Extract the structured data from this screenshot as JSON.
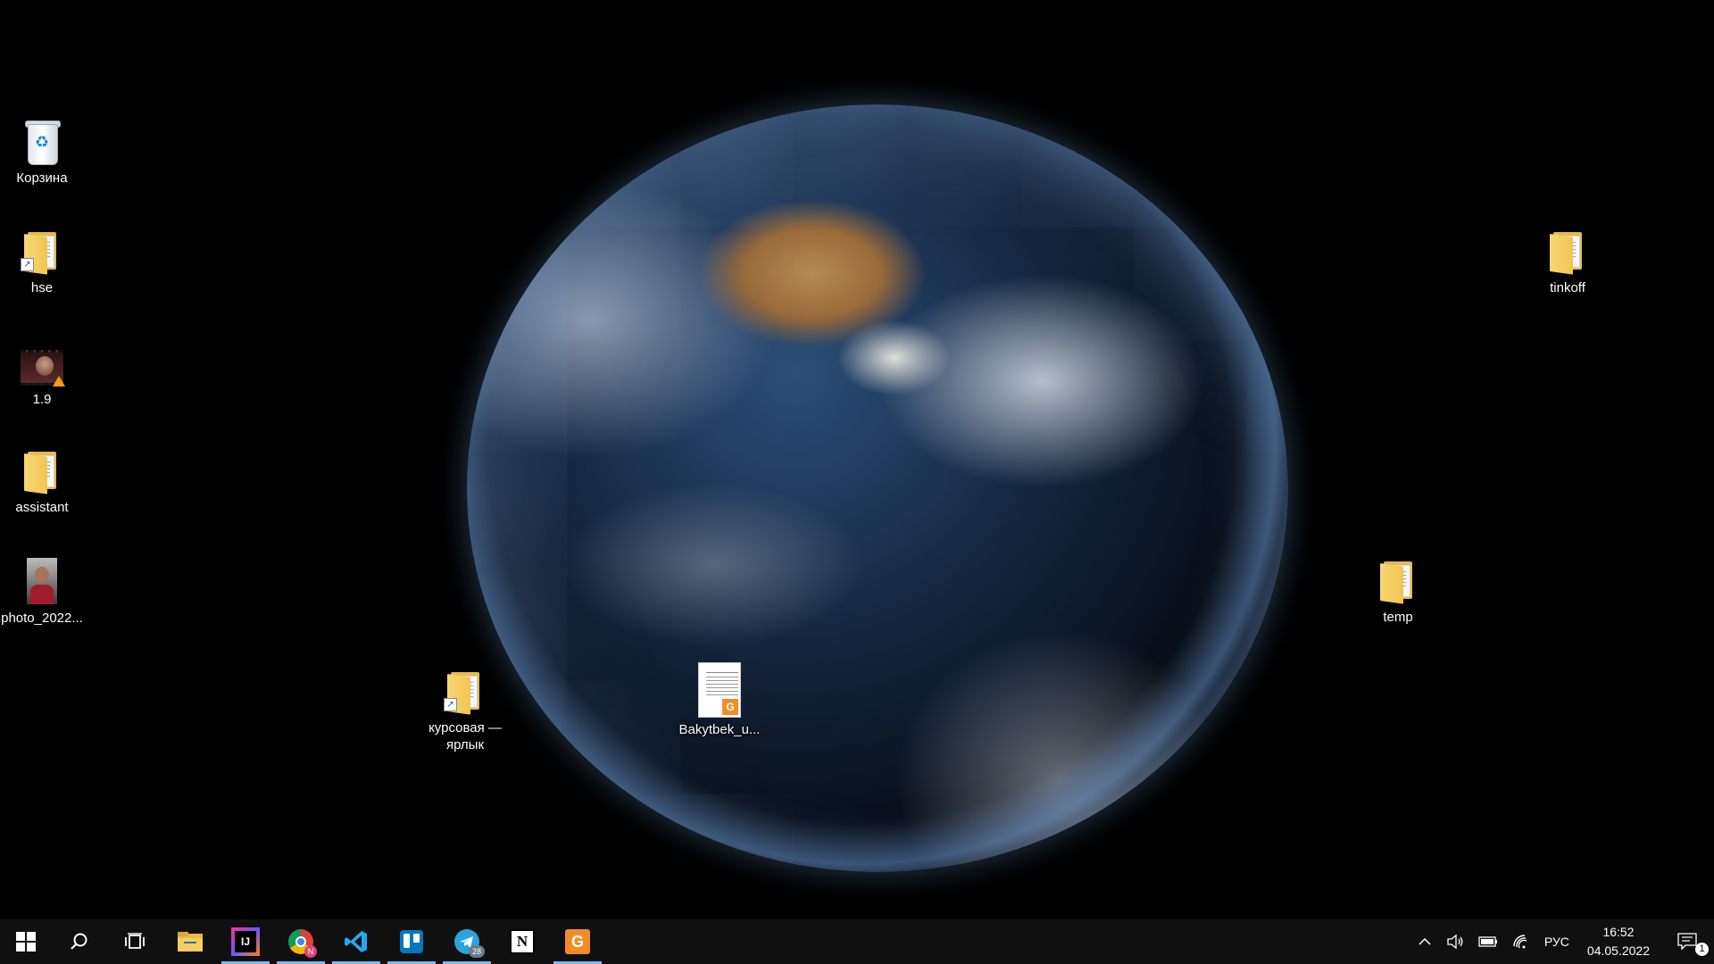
{
  "desktop": {
    "icons": [
      {
        "label": "Корзина",
        "type": "recycle-bin"
      },
      {
        "label": "hse",
        "type": "folder-shortcut"
      },
      {
        "label": "1.9",
        "type": "video"
      },
      {
        "label": "assistant",
        "type": "folder"
      },
      {
        "label": "photo_2022...",
        "type": "image"
      },
      {
        "label": "tinkoff",
        "type": "folder"
      },
      {
        "label": "temp",
        "type": "folder"
      },
      {
        "label": "курсовая — ярлык",
        "type": "folder-shortcut"
      },
      {
        "label": "Bakytbek_u...",
        "type": "pdf"
      }
    ]
  },
  "taskbar": {
    "apps": [
      {
        "name": "Start",
        "icon": "windows-logo-icon",
        "active": false
      },
      {
        "name": "Search",
        "icon": "search-icon",
        "active": false
      },
      {
        "name": "Task View",
        "icon": "task-view-icon",
        "active": false
      },
      {
        "name": "File Explorer",
        "icon": "file-explorer-icon",
        "active": false
      },
      {
        "name": "IntelliJ IDEA",
        "icon": "intellij-icon",
        "glyph": "IJ",
        "active": true
      },
      {
        "name": "Google Chrome",
        "icon": "chrome-icon",
        "badge": "N",
        "active": true
      },
      {
        "name": "Visual Studio Code",
        "icon": "vscode-icon",
        "active": true
      },
      {
        "name": "Trello",
        "icon": "trello-icon",
        "active": true
      },
      {
        "name": "Telegram",
        "icon": "telegram-icon",
        "badge": "28",
        "active": true
      },
      {
        "name": "Notion",
        "icon": "notion-icon",
        "glyph": "N",
        "active": false
      },
      {
        "name": "PDF Reader",
        "icon": "pdf-reader-icon",
        "active": true
      }
    ],
    "tray": {
      "language": "РУС",
      "time": "16:52",
      "date": "04.05.2022",
      "notifications_count": "1"
    }
  },
  "colors": {
    "taskbar_bg": "#101010",
    "active_indicator": "#76b9ed",
    "folder": "#f2c452"
  }
}
